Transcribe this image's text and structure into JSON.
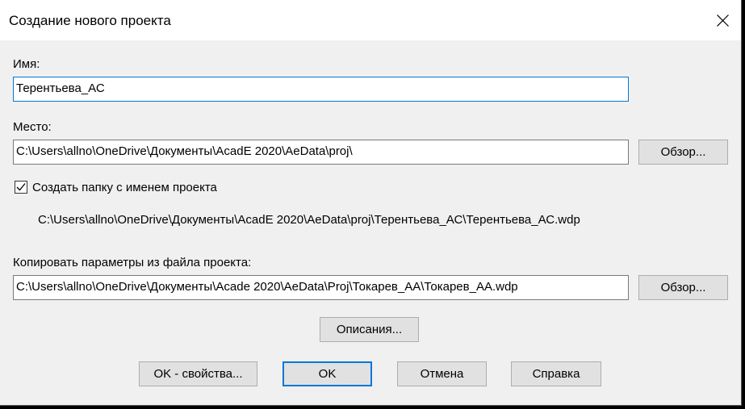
{
  "window": {
    "title": "Создание нового проекта"
  },
  "name_field": {
    "label": "Имя:",
    "value": "Терентьева_АС"
  },
  "location_field": {
    "label": "Место:",
    "value": "C:\\Users\\allno\\OneDrive\\Документы\\AcadE 2020\\AeData\\proj\\",
    "browse_label": "Обзор..."
  },
  "create_folder": {
    "label": "Создать папку с именем проекта",
    "checked": true,
    "result_path": "C:\\Users\\allno\\OneDrive\\Документы\\AcadE 2020\\AeData\\proj\\Терентьева_АС\\Терентьева_АС.wdp"
  },
  "copy_settings": {
    "label": "Копировать параметры из файла проекта:",
    "value": "C:\\Users\\allno\\OneDrive\\Документы\\Acade 2020\\AeData\\Proj\\Токарев_АА\\Токарев_АА.wdp",
    "browse_label": "Обзор..."
  },
  "buttons": {
    "descriptions": "Описания...",
    "ok_properties": "OK - свойства...",
    "ok": "OK",
    "cancel": "Отмена",
    "help": "Справка"
  },
  "colors": {
    "accent": "#0078d7",
    "dialog_bg": "#f0f0f0",
    "titlebar_bg": "#ffffff",
    "button_bg": "#e1e1e1"
  }
}
